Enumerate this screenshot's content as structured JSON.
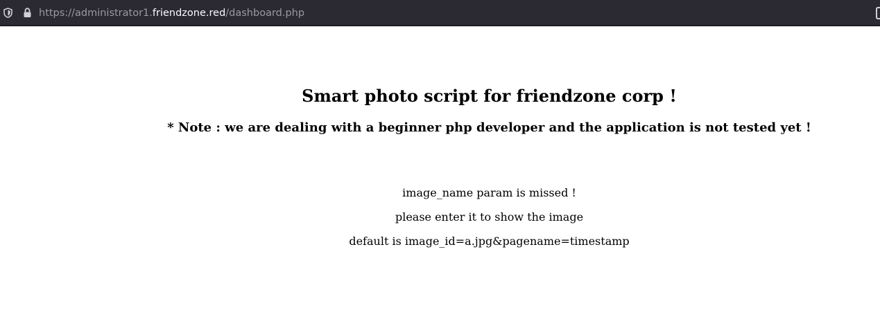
{
  "browser": {
    "url_scheme": "https://",
    "url_subdomain": "administrator1.",
    "url_domain": "friendzone.red",
    "url_path": "/dashboard.php",
    "shield_icon": "tracking-protection-shield-icon",
    "lock_icon": "padlock-icon"
  },
  "page": {
    "title": "Smart photo script for friendzone corp !",
    "note": "* Note : we are dealing with a beginner php developer and the application is not tested yet !",
    "messages": [
      "image_name param is missed !",
      "please enter it to show the image",
      "default is image_id=a.jpg&pagename=timestamp"
    ]
  }
}
